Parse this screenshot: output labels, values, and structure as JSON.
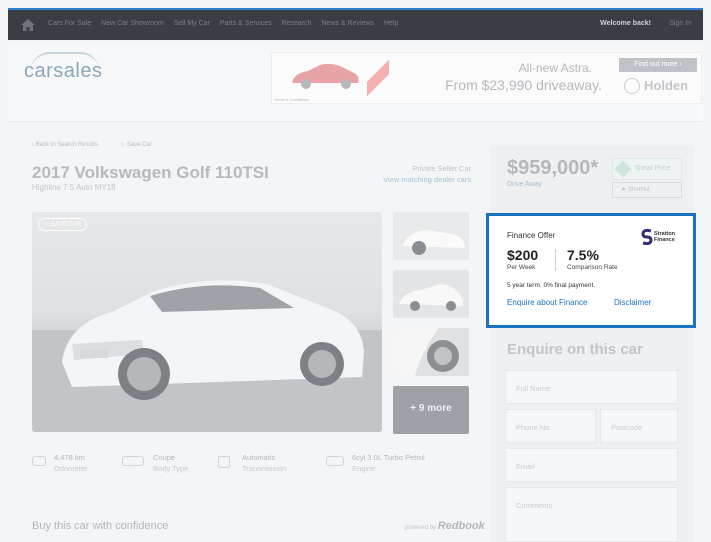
{
  "topnav": {
    "items": [
      "Cars For Sale",
      "New Car Showroom",
      "Sell My Car",
      "Parts & Services",
      "Research",
      "News & Reviews",
      "Help"
    ],
    "welcome": "Welcome back!",
    "signin": "Sign In"
  },
  "header": {
    "logo": "carsales",
    "ad": {
      "line1": "All-new Astra.",
      "line2": "From $23,990 driveaway.",
      "cta": "Find out more ›",
      "brand": "Holden",
      "terms": "Terms & Conditions"
    }
  },
  "breadcrumb": {
    "back": "Back to Search Results",
    "save": "Save Car"
  },
  "listing": {
    "title": "2017 Volkswagen Golf 110TSI",
    "subtitle": "Highline 7.5 Auto MY18",
    "seller_type": "Private Seller Car",
    "seller_link": "View matching dealer cars",
    "save_badge": "SAVE CAR",
    "more_photos": "+ 9 more"
  },
  "specs": [
    {
      "value": "4,478 km",
      "label": "Odometer"
    },
    {
      "value": "Coupe",
      "label": "Body Type"
    },
    {
      "value": "Automatic",
      "label": "Transmission"
    },
    {
      "value": "6cyl 3.0L Turbo Petrol",
      "label": "Engine"
    }
  ],
  "confidence": {
    "title": "Buy this car with confidence",
    "powered_by": "powered by",
    "brand": "Redbook"
  },
  "price": {
    "amount": "$959,000*",
    "note": "Drive Away",
    "badge": "Great Price",
    "shortlist": "Shortlist"
  },
  "finance": {
    "title": "Finance Offer",
    "logo": "Stratton Finance",
    "weekly_amount": "$200",
    "weekly_label": "Per Week",
    "rate": "7.5%",
    "rate_label": "Comparison Rate",
    "term": "5 year term. 0% final payment.",
    "enquire": "Enquire about Finance",
    "disclaimer": "Disclaimer"
  },
  "enquiry": {
    "title": "Enquire on this car",
    "full_name": "Full Name",
    "phone": "Phone No.",
    "postcode": "Postcode",
    "email": "Email",
    "comments": "Comments"
  },
  "colors": {
    "accent": "#1b72c1",
    "topbar": "#3a3d42"
  }
}
